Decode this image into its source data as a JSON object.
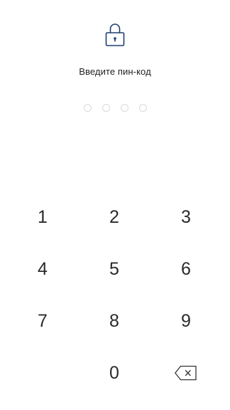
{
  "pin_screen": {
    "prompt": "Введите пин-код",
    "dots_filled": 0,
    "dots_total": 4,
    "lock_color": "#1f3f6e"
  },
  "keypad": {
    "keys": [
      "1",
      "2",
      "3",
      "4",
      "5",
      "6",
      "7",
      "8",
      "9",
      "",
      "0",
      "backspace"
    ],
    "backspace_icon": "backspace-icon"
  }
}
